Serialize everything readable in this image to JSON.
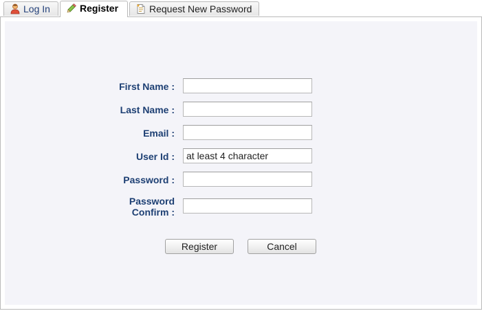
{
  "tabs": {
    "login": {
      "label": "Log In",
      "icon": "user-icon"
    },
    "register": {
      "label": "Register",
      "icon": "pencil-icon"
    },
    "request": {
      "label": "Request New Password",
      "icon": "document-icon"
    }
  },
  "form": {
    "first_name_label": "First Name :",
    "last_name_label": "Last Name :",
    "email_label": "Email :",
    "userid_label": "User Id :",
    "userid_placeholder": "at least 4 character",
    "password_label": "Password :",
    "password_confirm_label_line1": "Password",
    "password_confirm_label_line2": "Confirm :"
  },
  "buttons": {
    "register_label": "Register",
    "cancel_label": "Cancel"
  },
  "colors": {
    "label": "#1d3f73",
    "panel_background": "#f4f4f9"
  }
}
